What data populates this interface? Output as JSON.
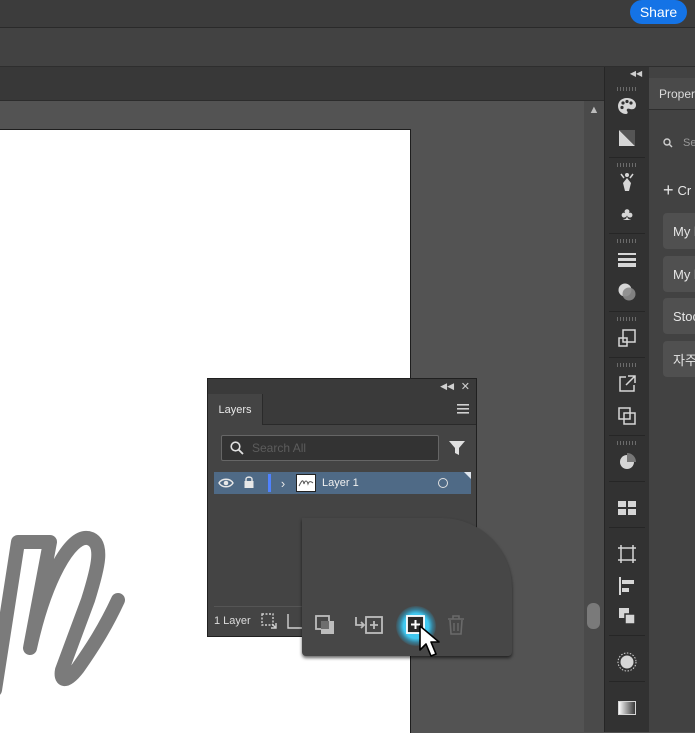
{
  "header": {
    "share_label": "Share"
  },
  "colors": {
    "accent": "#1473e6",
    "selection": "#4f6a86",
    "layer_color": "#4f82ff",
    "glow": "#3fc6ee"
  },
  "toolbar": {
    "items": [
      "palette-icon",
      "gradient-triangle-icon",
      "puppet-warp-icon",
      "club-symbol-icon",
      "stroke-lines-icon",
      "transparency-circles-icon",
      "transform-icon",
      "export-icon",
      "pathfinder-icon",
      "recolor-icon",
      "swatch-grid-icon",
      "artboard-icon",
      "align-icon",
      "links-icon",
      "glow-circle-icon",
      "gradient-swatch-icon"
    ]
  },
  "properties_panel": {
    "tab_label": "Proper",
    "search_placeholder": "Se",
    "create_label": "Cr",
    "items": [
      "My l",
      "My l",
      "Stoc",
      "자주"
    ]
  },
  "layers_panel": {
    "tab_label": "Layers",
    "search_placeholder": "Search All",
    "layers": [
      {
        "name": "Layer 1",
        "visible": true,
        "expanded": false
      }
    ],
    "footer_count": "1 Layer"
  }
}
